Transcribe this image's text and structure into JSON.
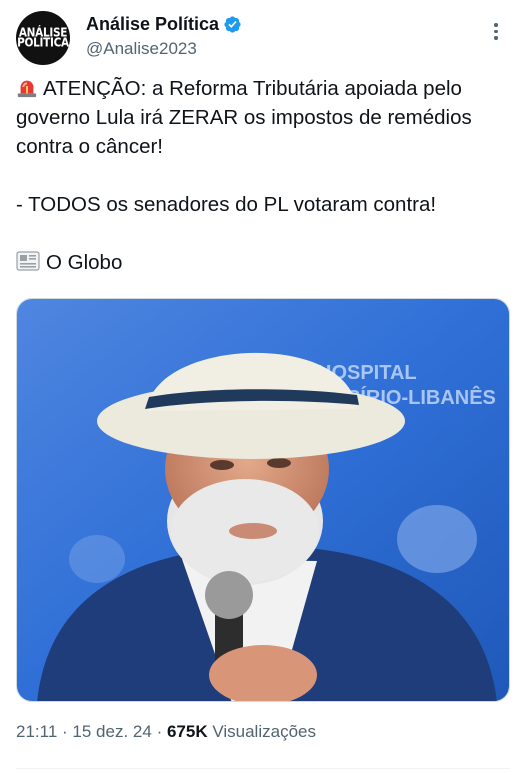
{
  "author": {
    "display_name": "Análise Política",
    "handle": "@Analise2023",
    "avatar_text_line1": "ANÁLISE",
    "avatar_text_line2": "POLÍTICA",
    "verified_color": "#1d9bf0"
  },
  "post": {
    "line1": "ATENÇÃO: a Reforma Tributária apoiada pelo governo Lula irá ZERAR os impostos de remédios contra o câncer!",
    "line2": "- TODOS os senadores do PL votaram contra!",
    "line3": "O Globo",
    "icons": [
      "siren-icon",
      "newspaper-icon"
    ]
  },
  "photo": {
    "background_text_top": "HOSPITAL",
    "background_text_mid": "SÍRIO-LIBANÊS",
    "accent": "#2f6fd6"
  },
  "meta": {
    "time": "21:11",
    "date": "15 dez. 24",
    "views": "675K",
    "views_label": "Visualizações",
    "separator": "·"
  }
}
